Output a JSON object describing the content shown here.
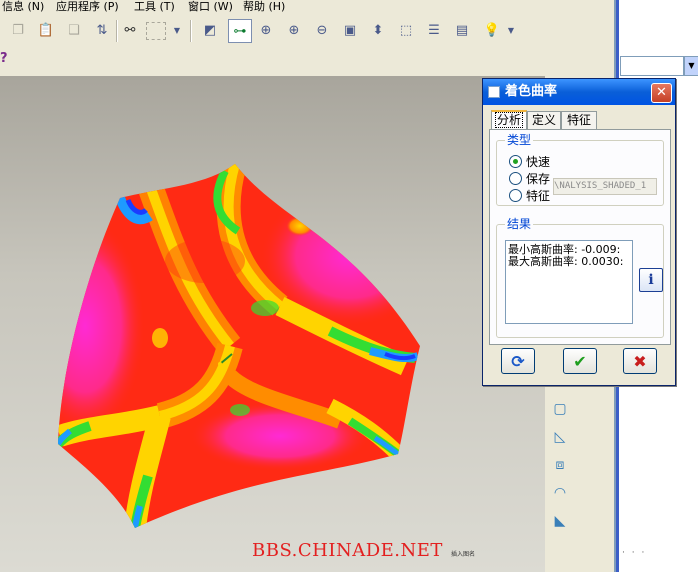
{
  "menubar": {
    "items": [
      "信息 (N)",
      "应用程序 (P)",
      "工具 (T)",
      "窗口 (W)",
      "帮助 (H)"
    ]
  },
  "toolbar": {
    "icons": [
      "copy-icon",
      "paste-icon",
      "paste-special-icon",
      "regenerate-icon",
      "find-icon",
      "select-box-icon",
      "dropdown-icon",
      "sketch-view-icon",
      "datum-point-icon",
      "spin-center-icon",
      "zoom-in-icon",
      "zoom-out-icon",
      "refit-icon",
      "orient-icon",
      "saved-views-icon",
      "layers-icon",
      "model-tree-icon",
      "lightbulb-icon",
      "dropdown-icon"
    ],
    "context_help": "?"
  },
  "right_panel": {
    "dots_top": "·  ·  ·",
    "dots_bottom": "·  ·  ·",
    "dropdown_arrow": "▼"
  },
  "side_strip": {
    "icons": [
      "plane-icon",
      "offset-icon",
      "draft-icon",
      "shell-icon",
      "round-icon",
      "chamfer-icon"
    ]
  },
  "dialog": {
    "title": "着色曲率",
    "close": "✕",
    "tabs": [
      "分析",
      "定义",
      "特征"
    ],
    "type_group": {
      "label": "类型",
      "options": [
        "快速",
        "保存",
        "特征"
      ],
      "selected": "快速",
      "name_value": "\\NALYSIS_SHADED_1"
    },
    "result_group": {
      "label": "结果",
      "lines": [
        "最小高斯曲率: -0.009:",
        "最大高斯曲率: 0.0030:"
      ],
      "info": "i"
    },
    "buttons": {
      "repeat": "⟳",
      "ok": "✔",
      "cancel": "✖"
    },
    "colors": {
      "title_bar": "#0a5fd8",
      "ok_check": "#1e9e1e",
      "cancel_x": "#c81e1e"
    }
  },
  "watermark": {
    "text": "BBS.CHINADE.NET",
    "small": "插入图名"
  },
  "surface": {
    "colors": [
      "#ff2a14",
      "#ff7a00",
      "#ffd400",
      "#33dd33",
      "#1e9bff",
      "#1a3cff",
      "#ff33cc"
    ]
  }
}
